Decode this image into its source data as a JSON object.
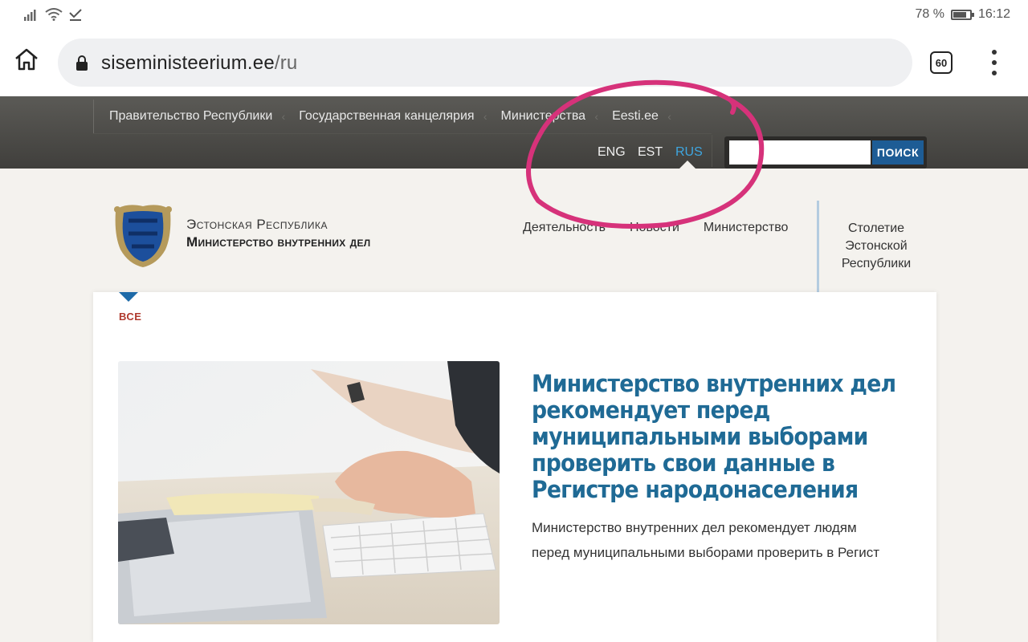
{
  "status_bar": {
    "battery_text": "78 %",
    "battery_level": 0.78,
    "time": "16:12"
  },
  "browser": {
    "url_domain": "siseministeerium.ee",
    "url_path": "/ru",
    "tab_count": "60"
  },
  "topnav": {
    "gov_links": [
      "Правительство Республики",
      "Государственная канцелярия",
      "Министерства",
      "Eesti.ee"
    ],
    "languages": [
      "ENG",
      "EST",
      "RUS"
    ],
    "active_language": "RUS",
    "search_button": "ПОИСК",
    "search_value": ""
  },
  "site_header": {
    "brand_line1": "Эстонская Республика",
    "brand_line2": "Министерство внутренних дел",
    "main_nav": [
      "Деятельность",
      "Новости",
      "Министерство"
    ],
    "centenary_link": "Столетие Эстонской Республики"
  },
  "content": {
    "filter_label": "ВСЕ",
    "article": {
      "title": "Министерство внутренних дел рекомендует перед муниципальными выборами проверить свои данные в Регистре народонаселения",
      "lead_line1": "Министерство внутренних дел рекомендует людям",
      "lead_line2": "перед муниципальными выборами проверить в Регист"
    }
  },
  "colors": {
    "accent_blue": "#1f6a95",
    "active_lang": "#3ea6e0",
    "annotation_pink": "#d6327a",
    "search_button_bg": "#1d5c95"
  }
}
